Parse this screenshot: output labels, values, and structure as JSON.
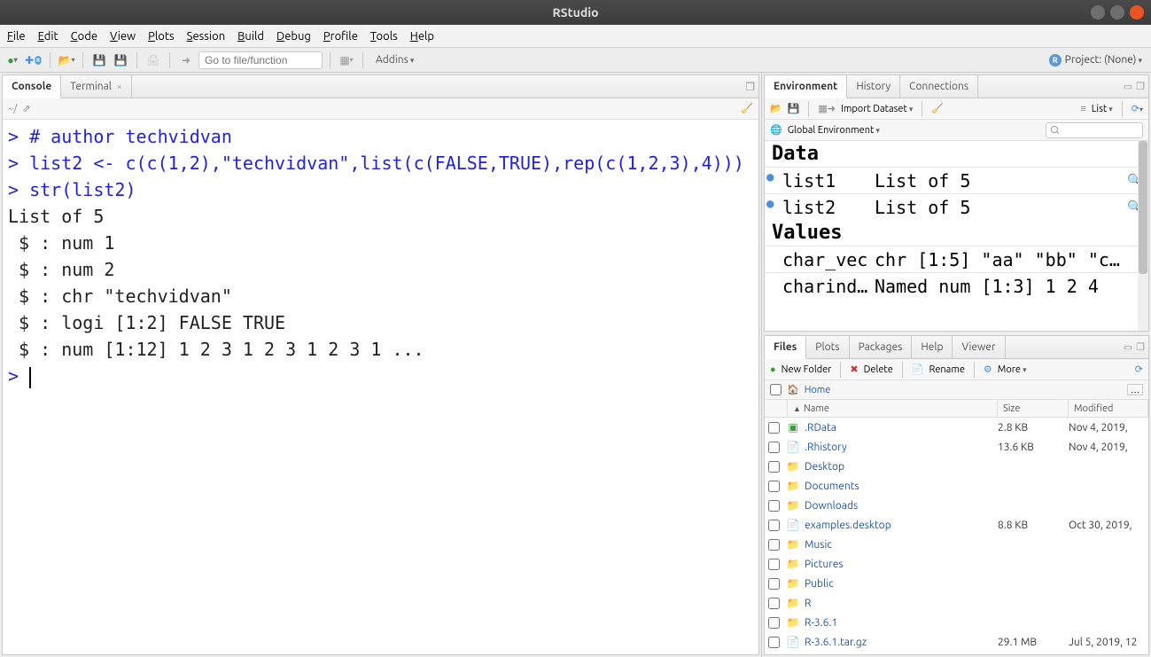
{
  "window": {
    "title": "RStudio"
  },
  "menubar": [
    "File",
    "Edit",
    "Code",
    "View",
    "Plots",
    "Session",
    "Build",
    "Debug",
    "Profile",
    "Tools",
    "Help"
  ],
  "toolbar": {
    "goto_placeholder": "Go to file/function",
    "addins": "Addins",
    "project_label": "Project: (None)"
  },
  "left_tabs": {
    "console": "Console",
    "terminal": "Terminal",
    "path": "~/"
  },
  "console": {
    "lines": [
      {
        "t": "cmd",
        "prompt": ">",
        "text": " # author techvidvan"
      },
      {
        "t": "cmd",
        "prompt": ">",
        "text": " list2 <- c(c(1,2),\"techvidvan\",list(c(FALSE,TRUE),rep(c(1,2,3),4)))"
      },
      {
        "t": "cmd",
        "prompt": ">",
        "text": " str(list2)"
      },
      {
        "t": "out",
        "text": "List of 5"
      },
      {
        "t": "out",
        "text": " $ : num 1"
      },
      {
        "t": "out",
        "text": " $ : num 2"
      },
      {
        "t": "out",
        "text": " $ : chr \"techvidvan\""
      },
      {
        "t": "out",
        "text": " $ : logi [1:2] FALSE TRUE"
      },
      {
        "t": "out",
        "text": " $ : num [1:12] 1 2 3 1 2 3 1 2 3 1 ..."
      },
      {
        "t": "cmd",
        "prompt": ">",
        "text": " ",
        "cursor": true
      }
    ]
  },
  "env_pane": {
    "tabs": [
      "Environment",
      "History",
      "Connections"
    ],
    "import": "Import Dataset",
    "list_label": "List",
    "scope": "Global Environment",
    "sections": {
      "data_header": "Data",
      "data": [
        {
          "name": "list1",
          "value": "List of 5"
        },
        {
          "name": "list2",
          "value": "List of 5"
        }
      ],
      "values_header": "Values",
      "values": [
        {
          "name": "char_vec",
          "value": "chr [1:5] \"aa\" \"bb\" \"c…"
        },
        {
          "name": "charind…",
          "value": "Named num [1:3] 1 2 4"
        }
      ]
    }
  },
  "files_pane": {
    "tabs": [
      "Files",
      "Plots",
      "Packages",
      "Help",
      "Viewer"
    ],
    "buttons": {
      "new_folder": "New Folder",
      "delete": "Delete",
      "rename": "Rename",
      "more": "More"
    },
    "breadcrumb": "Home",
    "cols": {
      "name": "Name",
      "size": "Size",
      "mod": "Modified"
    },
    "rows": [
      {
        "icon": "rdata",
        "name": ".RData",
        "size": "2.8 KB",
        "mod": "Nov 4, 2019,"
      },
      {
        "icon": "rhist",
        "name": ".Rhistory",
        "size": "13.6 KB",
        "mod": "Nov 4, 2019,"
      },
      {
        "icon": "folder",
        "name": "Desktop",
        "size": "",
        "mod": ""
      },
      {
        "icon": "folder",
        "name": "Documents",
        "size": "",
        "mod": ""
      },
      {
        "icon": "folder",
        "name": "Downloads",
        "size": "",
        "mod": ""
      },
      {
        "icon": "file",
        "name": "examples.desktop",
        "size": "8.8 KB",
        "mod": "Oct 30, 2019,"
      },
      {
        "icon": "folder",
        "name": "Music",
        "size": "",
        "mod": ""
      },
      {
        "icon": "folder",
        "name": "Pictures",
        "size": "",
        "mod": ""
      },
      {
        "icon": "folder-pub",
        "name": "Public",
        "size": "",
        "mod": ""
      },
      {
        "icon": "folder",
        "name": "R",
        "size": "",
        "mod": ""
      },
      {
        "icon": "folder",
        "name": "R-3.6.1",
        "size": "",
        "mod": ""
      },
      {
        "icon": "file",
        "name": "R-3.6.1.tar.gz",
        "size": "29.1 MB",
        "mod": "Jul 5, 2019, 12"
      }
    ]
  }
}
